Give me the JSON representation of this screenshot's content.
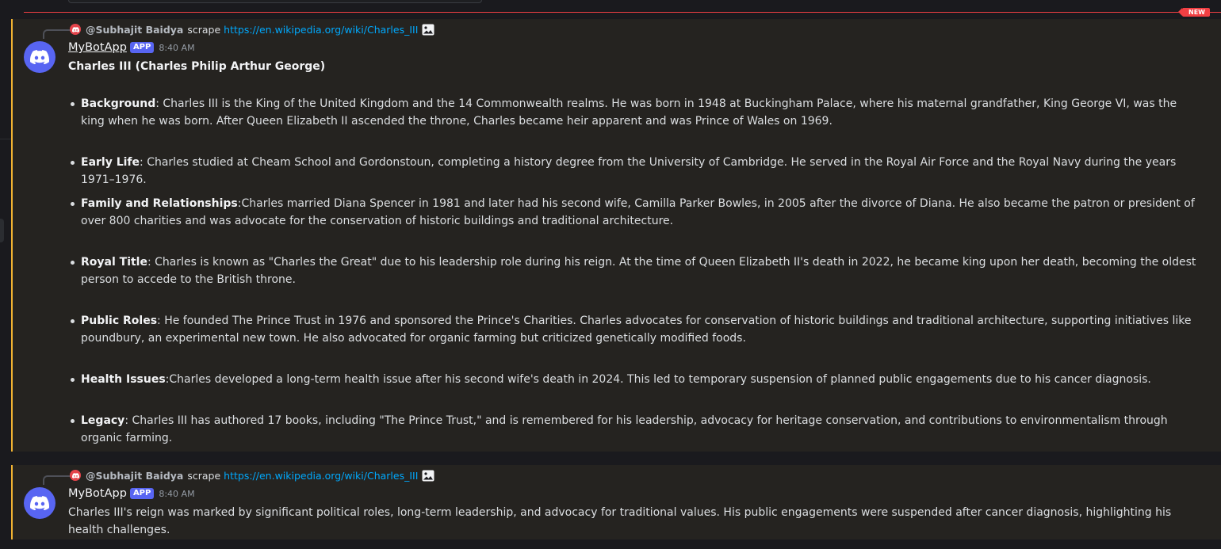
{
  "divider": {
    "badge": "NEW"
  },
  "message1": {
    "reply": {
      "author": "@Subhajit Baidya",
      "command": "scrape",
      "link": "https://en.wikipedia.org/wiki/Charles_III"
    },
    "username": "MyBotApp",
    "tag": "APP",
    "time": "8:40 AM",
    "title": "Charles III (Charles Philip Arthur George)",
    "bullets": [
      {
        "label": "Background",
        "text": ": Charles III is the King of the United Kingdom and the 14 Commonwealth realms. He was born in 1948 at Buckingham Palace, where his maternal grandfather, King George VI, was the king when he was born. After Queen Elizabeth II ascended the throne, Charles became heir apparent and was Prince of Wales on 1969."
      },
      {
        "label": "Early Life",
        "text": ": Charles studied at Cheam School and Gordonstoun, completing a history degree from the University of Cambridge. He served in the Royal Air Force and the Royal Navy during the years 1971–1976."
      },
      {
        "label": "Family and Relationships",
        "text": ":Charles married Diana Spencer in 1981 and later had his second wife, Camilla Parker Bowles, in 2005 after the divorce of Diana. He also became the patron or president of over 800 charities and was advocate for the conservation of historic buildings and traditional architecture."
      },
      {
        "label": "Royal Title",
        "text": ": Charles is known as \"Charles the Great\" due to his leadership role during his reign. At the time of Queen Elizabeth II's death in 2022, he became king upon her death, becoming the oldest person to accede to the British throne."
      },
      {
        "label": "Public Roles",
        "text": ": He founded The Prince Trust in 1976 and sponsored the Prince's Charities. Charles advocates for conservation of historic buildings and traditional architecture, supporting initiatives like poundbury, an experimental new town. He also advocated for organic farming but criticized genetically modified foods."
      },
      {
        "label": "Health Issues",
        "text": ":Charles developed a long-term health issue after his second wife's death in 2024. This led to temporary suspension of planned public engagements due to his cancer diagnosis."
      },
      {
        "label": "Legacy",
        "text": ": Charles III has authored 17 books, including \"The Prince Trust,\" and is remembered for his leadership, advocacy for heritage conservation, and contributions to environmentalism through organic farming."
      }
    ]
  },
  "message2": {
    "reply": {
      "author": "@Subhajit Baidya",
      "command": "scrape",
      "link": "https://en.wikipedia.org/wiki/Charles_III"
    },
    "username": "MyBotApp",
    "tag": "APP",
    "time": "8:40 AM",
    "text": "Charles III's reign was marked by significant political roles, long-term leadership, and advocacy for traditional values. His public engagements were suspended after cancer diagnosis, highlighting his health challenges."
  },
  "icons": {
    "avatar": "discord-logo-icon",
    "attachment": "image-icon"
  },
  "colors": {
    "accent": "#5865f2",
    "highlight_bar": "#f0b232",
    "new_divider": "#f23f43",
    "link": "#00a8fc"
  }
}
